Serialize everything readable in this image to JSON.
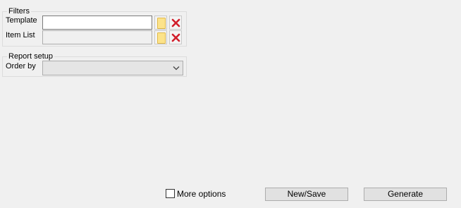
{
  "filters": {
    "title": "Filters",
    "template": {
      "label": "Template",
      "value": "",
      "browse_icon": "folder-icon",
      "clear_icon": "red-x-icon"
    },
    "item_list": {
      "label": "Item List",
      "value": "",
      "browse_icon": "folder-icon",
      "clear_icon": "red-x-icon"
    }
  },
  "report_setup": {
    "title": "Report setup",
    "order_by": {
      "label": "Order by",
      "value": ""
    }
  },
  "footer": {
    "more_options_label": "More options",
    "more_options_checked": false,
    "new_save_label": "New/Save",
    "generate_label": "Generate"
  },
  "colors": {
    "window_bg": "#f0f0f0",
    "delete_red": "#d11e2b",
    "folder_yellow": "#fce38a"
  }
}
